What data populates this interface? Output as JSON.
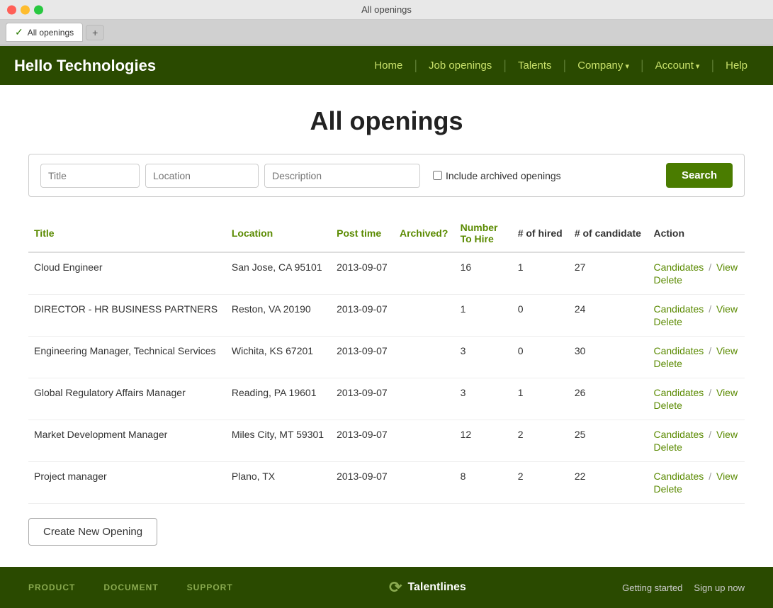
{
  "window": {
    "title": "All openings",
    "tab_label": "All openings"
  },
  "nav": {
    "logo": "Hello Technologies",
    "links": [
      {
        "label": "Home",
        "id": "home",
        "arrow": false
      },
      {
        "label": "Job openings",
        "id": "job-openings",
        "arrow": false
      },
      {
        "label": "Talents",
        "id": "talents",
        "arrow": false
      },
      {
        "label": "Company",
        "id": "company",
        "arrow": true
      },
      {
        "label": "Account",
        "id": "account",
        "arrow": true
      },
      {
        "label": "Help",
        "id": "help",
        "arrow": false
      }
    ]
  },
  "page": {
    "title": "All openings"
  },
  "search": {
    "title_placeholder": "Title",
    "location_placeholder": "Location",
    "description_placeholder": "Description",
    "checkbox_label": "Include archived openings",
    "button_label": "Search"
  },
  "table": {
    "headers": [
      {
        "label": "Title",
        "id": "col-title",
        "colored": true
      },
      {
        "label": "Location",
        "id": "col-location",
        "colored": true
      },
      {
        "label": "Post time",
        "id": "col-posttime",
        "colored": true
      },
      {
        "label": "Archived?",
        "id": "col-archived",
        "colored": true
      },
      {
        "label": "Number To Hire",
        "id": "col-numbertohire",
        "colored": true
      },
      {
        "label": "# of hired",
        "id": "col-hired",
        "colored": false
      },
      {
        "label": "# of candidate",
        "id": "col-candidate",
        "colored": false
      },
      {
        "label": "Action",
        "id": "col-action",
        "colored": false
      }
    ],
    "rows": [
      {
        "title": "Cloud Engineer",
        "location": "San Jose, CA 95101",
        "post_time": "2013-09-07",
        "archived": "",
        "number_to_hire": "16",
        "hired": "1",
        "candidates": "27",
        "actions": {
          "candidates": "Candidates",
          "view": "View",
          "delete": "Delete"
        }
      },
      {
        "title": "DIRECTOR - HR BUSINESS PARTNERS",
        "location": "Reston, VA 20190",
        "post_time": "2013-09-07",
        "archived": "",
        "number_to_hire": "1",
        "hired": "0",
        "candidates": "24",
        "actions": {
          "candidates": "Candidates",
          "view": "View",
          "delete": "Delete"
        }
      },
      {
        "title": "Engineering Manager, Technical Services",
        "location": "Wichita, KS 67201",
        "post_time": "2013-09-07",
        "archived": "",
        "number_to_hire": "3",
        "hired": "0",
        "candidates": "30",
        "actions": {
          "candidates": "Candidates",
          "view": "View",
          "delete": "Delete"
        }
      },
      {
        "title": "Global Regulatory Affairs Manager",
        "location": "Reading, PA 19601",
        "post_time": "2013-09-07",
        "archived": "",
        "number_to_hire": "3",
        "hired": "1",
        "candidates": "26",
        "actions": {
          "candidates": "Candidates",
          "view": "View",
          "delete": "Delete"
        }
      },
      {
        "title": "Market Development Manager",
        "location": "Miles City, MT 59301",
        "post_time": "2013-09-07",
        "archived": "",
        "number_to_hire": "12",
        "hired": "2",
        "candidates": "25",
        "actions": {
          "candidates": "Candidates",
          "view": "View",
          "delete": "Delete"
        }
      },
      {
        "title": "Project manager",
        "location": "Plano, TX",
        "post_time": "2013-09-07",
        "archived": "",
        "number_to_hire": "8",
        "hired": "2",
        "candidates": "22",
        "actions": {
          "candidates": "Candidates",
          "view": "View",
          "delete": "Delete"
        }
      }
    ]
  },
  "create_button": "Create New Opening",
  "footer": {
    "col1_label": "PRODUCT",
    "col2_label": "DOCUMENT",
    "col3_label": "SUPPORT",
    "logo_text": "Talentlines",
    "link1": "Getting started",
    "link2": "Sign up now"
  }
}
